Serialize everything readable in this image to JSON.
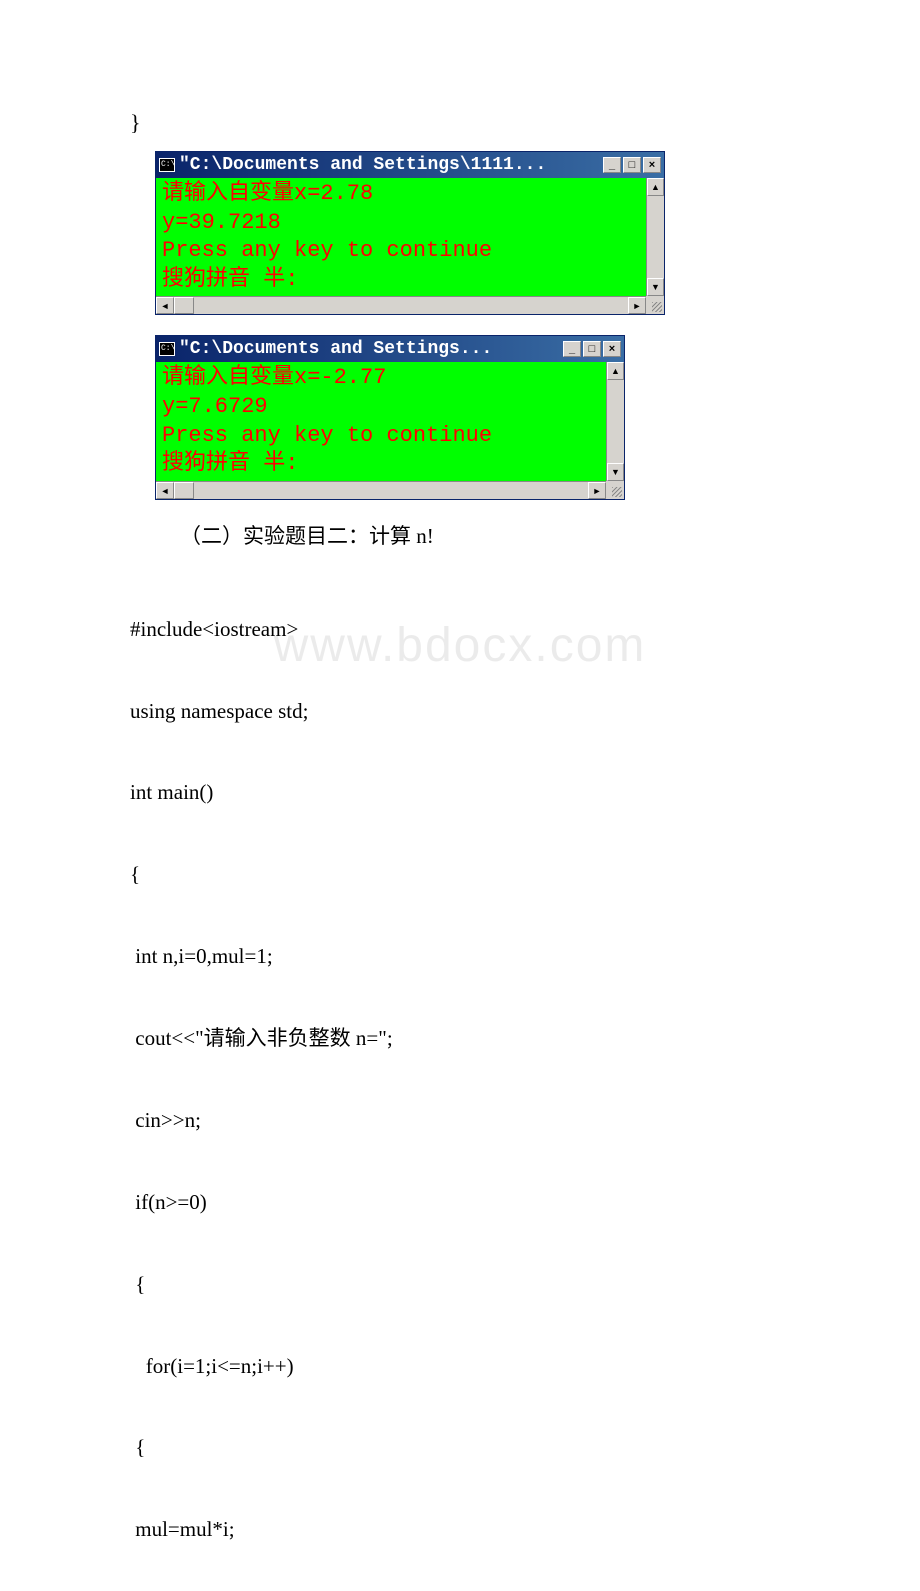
{
  "brace": "}",
  "console1": {
    "title": "\"C:\\Documents and Settings\\1111...",
    "line1": "请输入自变量x=2.78",
    "line2": "y=39.7218",
    "line3": "Press any key to continue",
    "line4": "搜狗拼音 半:"
  },
  "console2": {
    "title": "\"C:\\Documents and Settings...",
    "line1": "请输入自变量x=-2.77",
    "line2": "y=7.6729",
    "line3": "Press any key to continue",
    "line4": "搜狗拼音 半:"
  },
  "watermark": "www.bdocx.com",
  "heading": "（二）实验题目二：计算 n!",
  "code": {
    "l1": "#include<iostream>",
    "l2": "using namespace std;",
    "l3": "int main()",
    "l4": "{",
    "l5": " int n,i=0,mul=1;",
    "l6": " cout<<\"请输入非负整数 n=\";",
    "l7": " cin>>n;",
    "l8": " if(n>=0)",
    "l9": " {",
    "l10": "   for(i=1;i<=n;i++)",
    "l11": " {",
    "l12": " mul=mul*i;"
  },
  "btn": {
    "min": "_",
    "max": "□",
    "close": "×",
    "up": "▲",
    "down": "▼",
    "left": "◄",
    "right": "►"
  },
  "icon_text": "C:\\"
}
